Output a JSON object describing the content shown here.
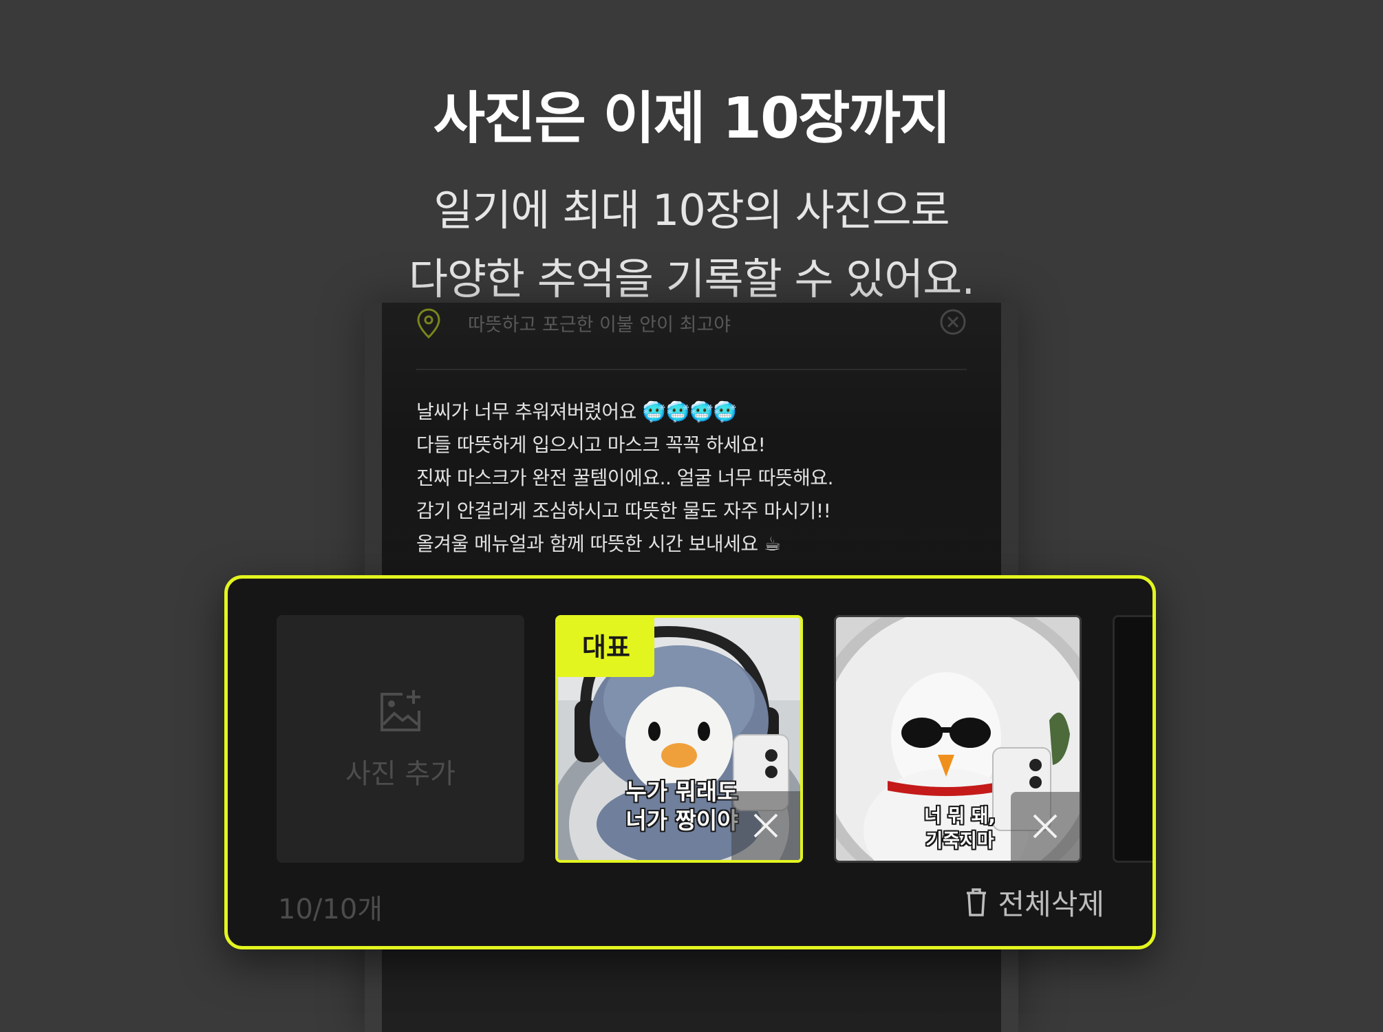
{
  "headline": "사진은 이제 10장까지",
  "subline": {
    "line1": "일기에 최대 10장의 사진으로",
    "line2": "다양한 추억을 기록할 수 있어요."
  },
  "location": {
    "text": "따뜻하고 포근한 이불 안이 최고야",
    "icon": "location-pin-icon",
    "clear_icon": "clear-icon"
  },
  "diary": {
    "lines": [
      "날씨가 너무 추워져버렸어요 🥶🥶🥶🥶",
      "다들 따뜻하게 입으시고 마스크 꼭꼭 하세요!",
      "진짜 마스크가 완전 꿀템이에요.. 얼굴 너무 따뜻해요.",
      "감기 안걸리게 조심하시고 따뜻한 물도 자주 마시기!!",
      "올겨울 메뉴얼과 함께 따뜻한 시간 보내세요 ☕"
    ]
  },
  "photo_panel": {
    "add_photo_label": "사진 추가",
    "representative_badge": "대표",
    "photos": [
      {
        "caption_line1": "누가 뭐래도",
        "caption_line2": "너가 짱이야"
      },
      {
        "caption_line1": "너 뭐 돼,",
        "caption_line2": "기죽지마"
      }
    ],
    "counter": "10/10개",
    "delete_all_label": "전체삭제"
  },
  "colors": {
    "accent": "#e3f51f",
    "background": "#3a3a3a",
    "panel": "#161616"
  }
}
